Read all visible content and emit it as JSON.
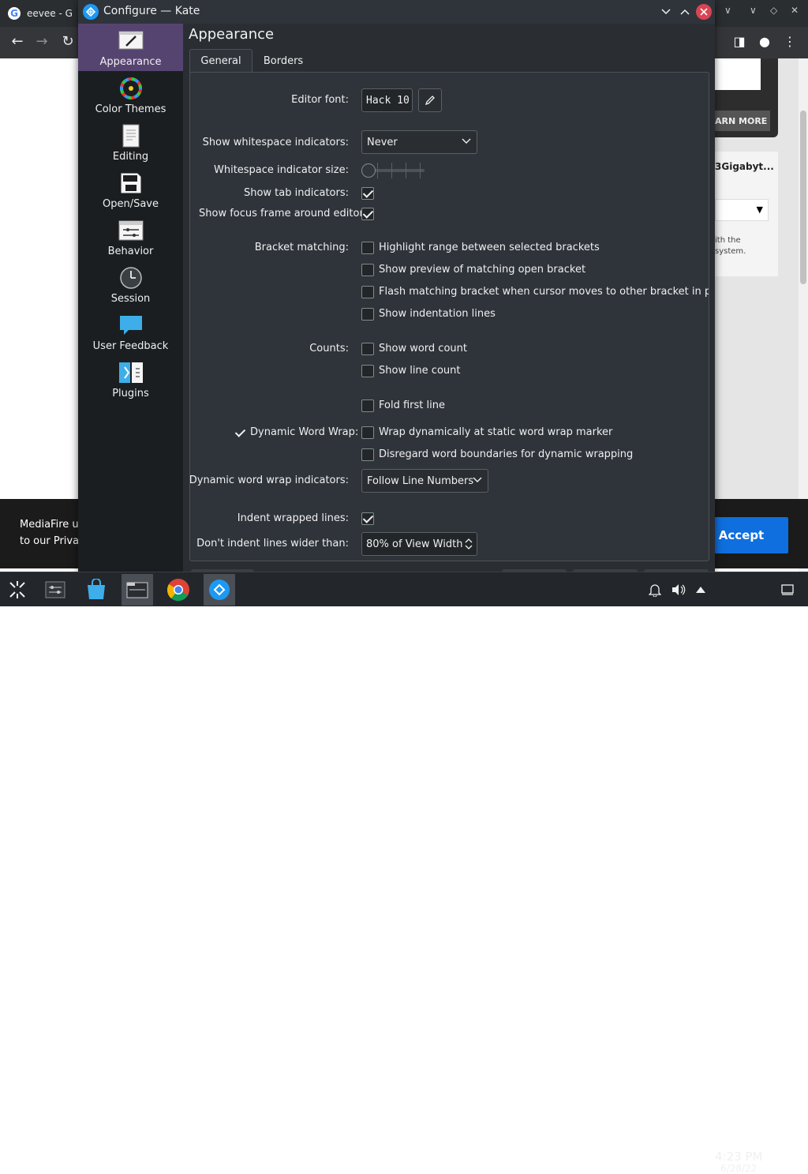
{
  "browser": {
    "tab_title": "eevee - G",
    "tab_icon": "G",
    "nav": {
      "back": "←",
      "forward": "→",
      "reload": "↻"
    }
  },
  "webpage": {
    "learn_more": "ARN MORE",
    "product_title": "3Gigabyt...",
    "small_text_1": "ith the",
    "small_text_2": "system.",
    "cookie_line1": "MediaFire us",
    "cookie_line2": "to our Privac",
    "accept": "Accept"
  },
  "dialog": {
    "title": "Configure — Kate",
    "sidebar": [
      {
        "label": "Appearance",
        "icon": "appearance-icon",
        "active": true
      },
      {
        "label": "Color Themes",
        "icon": "color-themes-icon",
        "active": false
      },
      {
        "label": "Editing",
        "icon": "editing-icon",
        "active": false
      },
      {
        "label": "Open/Save",
        "icon": "save-icon",
        "active": false
      },
      {
        "label": "Behavior",
        "icon": "behavior-icon",
        "active": false
      },
      {
        "label": "Session",
        "icon": "session-clock-icon",
        "active": false
      },
      {
        "label": "User Feedback",
        "icon": "feedback-icon",
        "active": false
      },
      {
        "label": "Plugins",
        "icon": "plugins-icon",
        "active": false
      }
    ],
    "page_title": "Appearance",
    "tabs": [
      "General",
      "Borders"
    ],
    "general": {
      "editor_font_label": "Editor font:",
      "editor_font_value": "Hack 10",
      "whitespace_label": "Show whitespace indicators:",
      "whitespace_value": "Never",
      "ws_size_label": "Whitespace indicator size:",
      "ws_size_level": 0,
      "show_tab_label": "Show tab indicators:",
      "show_tab_checked": true,
      "focus_frame_label": "Show focus frame around editor",
      "focus_frame_checked": true,
      "bracket_label": "Bracket matching:",
      "bracket_options": [
        {
          "label": "Highlight range between selected brackets",
          "checked": false
        },
        {
          "label": "Show preview of matching open bracket",
          "checked": false
        },
        {
          "label": "Flash matching bracket when cursor moves to other bracket in pair",
          "checked": false
        },
        {
          "label": "Show indentation lines",
          "checked": false
        }
      ],
      "counts_label": "Counts:",
      "counts_options": [
        {
          "label": "Show word count",
          "checked": false
        },
        {
          "label": "Show line count",
          "checked": false
        }
      ],
      "fold_first_line": "Fold first line",
      "dyn_wrap_label": "Dynamic Word Wrap:",
      "dyn_wrap_checked": true,
      "dyn_wrap_options": [
        {
          "label": "Wrap dynamically at static word wrap marker",
          "checked": false
        },
        {
          "label": "Disregard word boundaries for dynamic wrapping",
          "checked": false
        }
      ],
      "dyn_wrap_ind_label": "Dynamic word wrap indicators:",
      "dyn_wrap_ind_value": "Follow Line Numbers",
      "indent_wrapped_label": "Indent wrapped lines:",
      "indent_wrapped_checked": true,
      "dont_indent_label": "Don't indent lines wider than:",
      "dont_indent_value": "80% of View Width"
    }
  },
  "taskbar": {
    "time": "4:23 PM",
    "date": "6/28/22"
  },
  "colors": {
    "accent": "#564470",
    "dialog_bg": "#2a2e32",
    "sidebar_bg": "#1b1e20",
    "close_red": "#da4453",
    "accept_blue": "#0f6fde"
  }
}
